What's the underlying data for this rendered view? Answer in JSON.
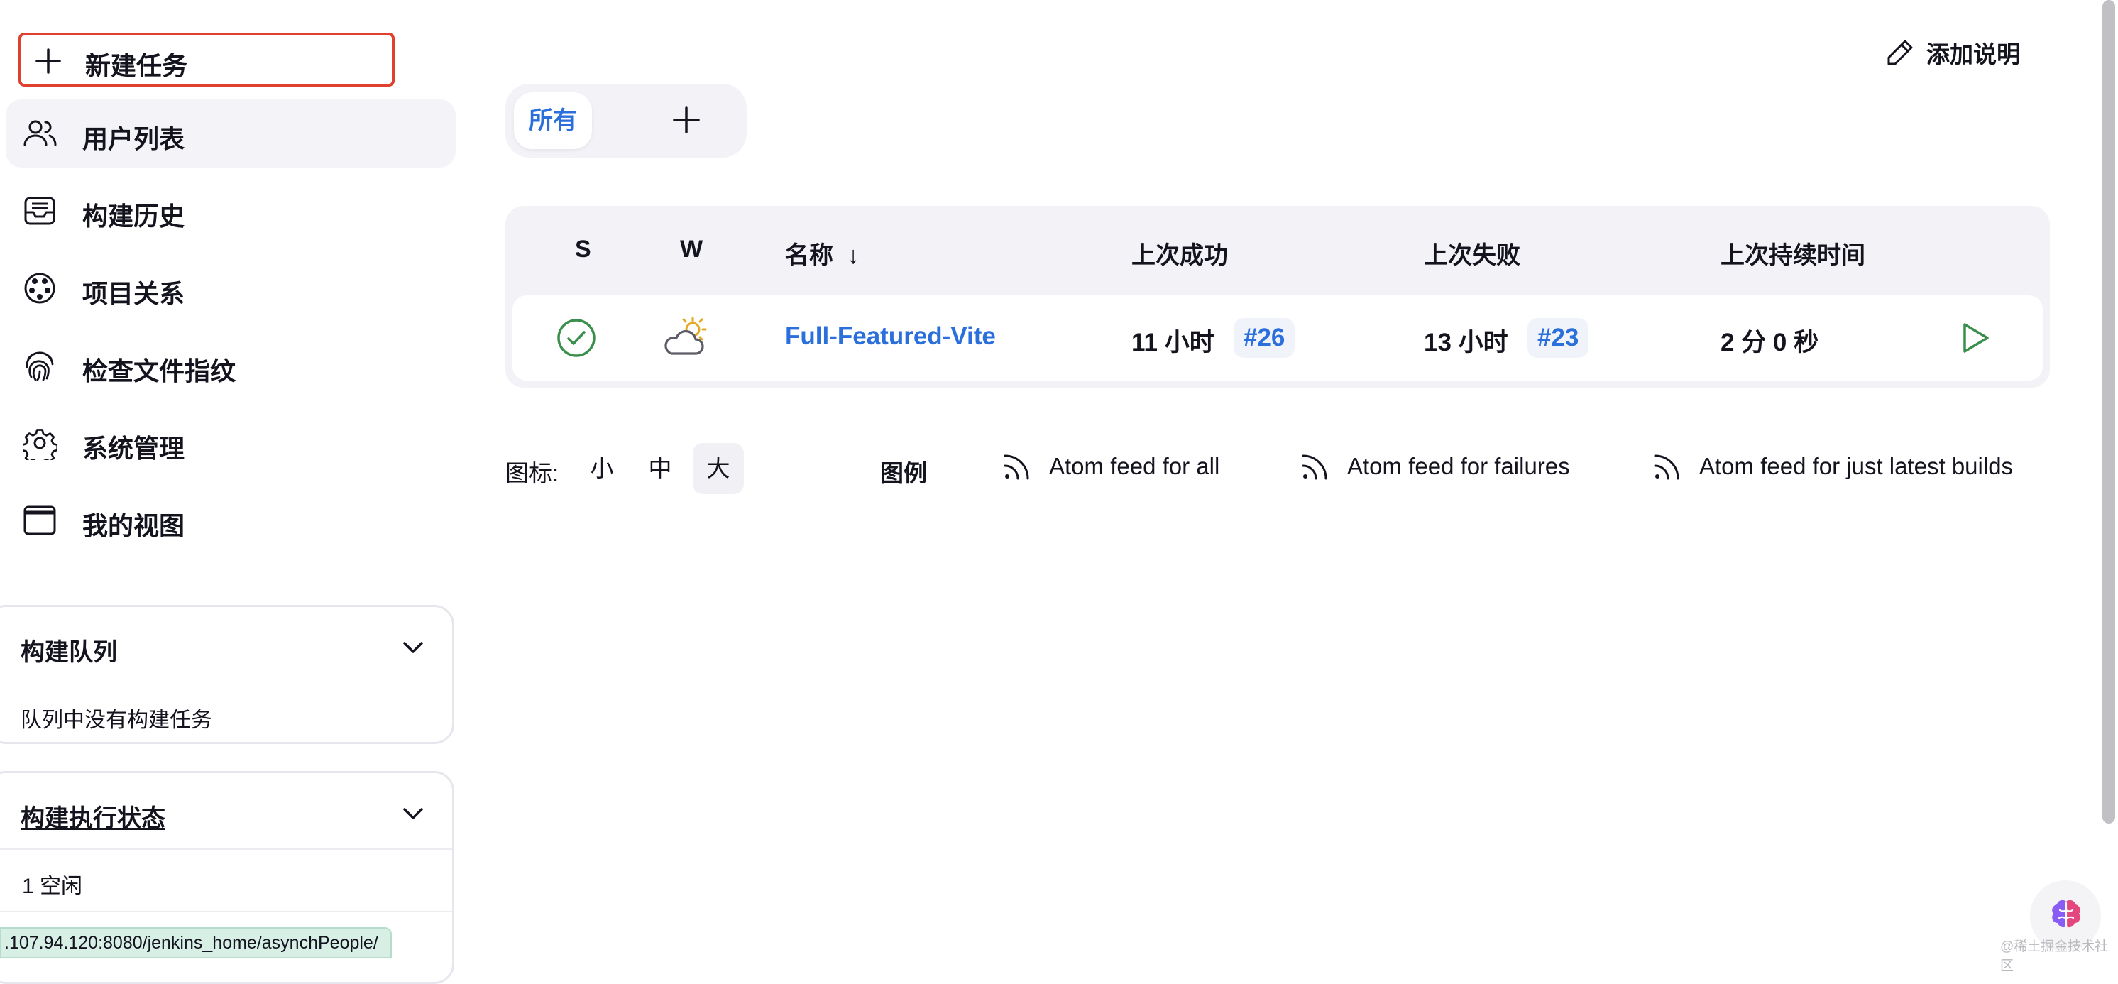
{
  "sidebar": {
    "new_task": "新建任务",
    "items": [
      {
        "label": "用户列表",
        "icon": "users-icon"
      },
      {
        "label": "构建历史",
        "icon": "inbox-icon"
      },
      {
        "label": "项目关系",
        "icon": "relations-icon"
      },
      {
        "label": "检查文件指纹",
        "icon": "fingerprint-icon"
      },
      {
        "label": "系统管理",
        "icon": "gear-icon"
      },
      {
        "label": "我的视图",
        "icon": "window-icon"
      }
    ],
    "build_queue": {
      "title": "构建队列",
      "empty_text": "队列中没有构建任务"
    },
    "executor_status": {
      "title": "构建执行状态",
      "executor": "1  空闲"
    }
  },
  "status_bar_url": ".107.94.120:8080/jenkins_home/asynchPeople/",
  "header": {
    "add_description": "添加说明"
  },
  "tabs": {
    "all": "所有"
  },
  "table": {
    "headers": {
      "s": "S",
      "w": "W",
      "name": "名称",
      "sort_arrow": "↓",
      "last_success": "上次成功",
      "last_failure": "上次失败",
      "last_duration": "上次持续时间"
    },
    "rows": [
      {
        "status": "success",
        "weather": "partly-sunny",
        "name": "Full-Featured-Vite",
        "last_success_time": "11 小时",
        "last_success_build": "#26",
        "last_failure_time": "13 小时",
        "last_failure_build": "#23",
        "duration": "2 分 0 秒"
      }
    ]
  },
  "footer": {
    "icon_label": "图标:",
    "sizes": [
      "小",
      "中",
      "大"
    ],
    "selected_size": "大",
    "legend": "图例",
    "feeds": [
      "Atom feed for all",
      "Atom feed for failures",
      "Atom feed for just latest builds"
    ]
  },
  "colors": {
    "accent": "#2a6fdb",
    "success": "#3a8f4c",
    "highlight_border": "#e0412f"
  },
  "watermark": "@稀土掘金技术社区"
}
